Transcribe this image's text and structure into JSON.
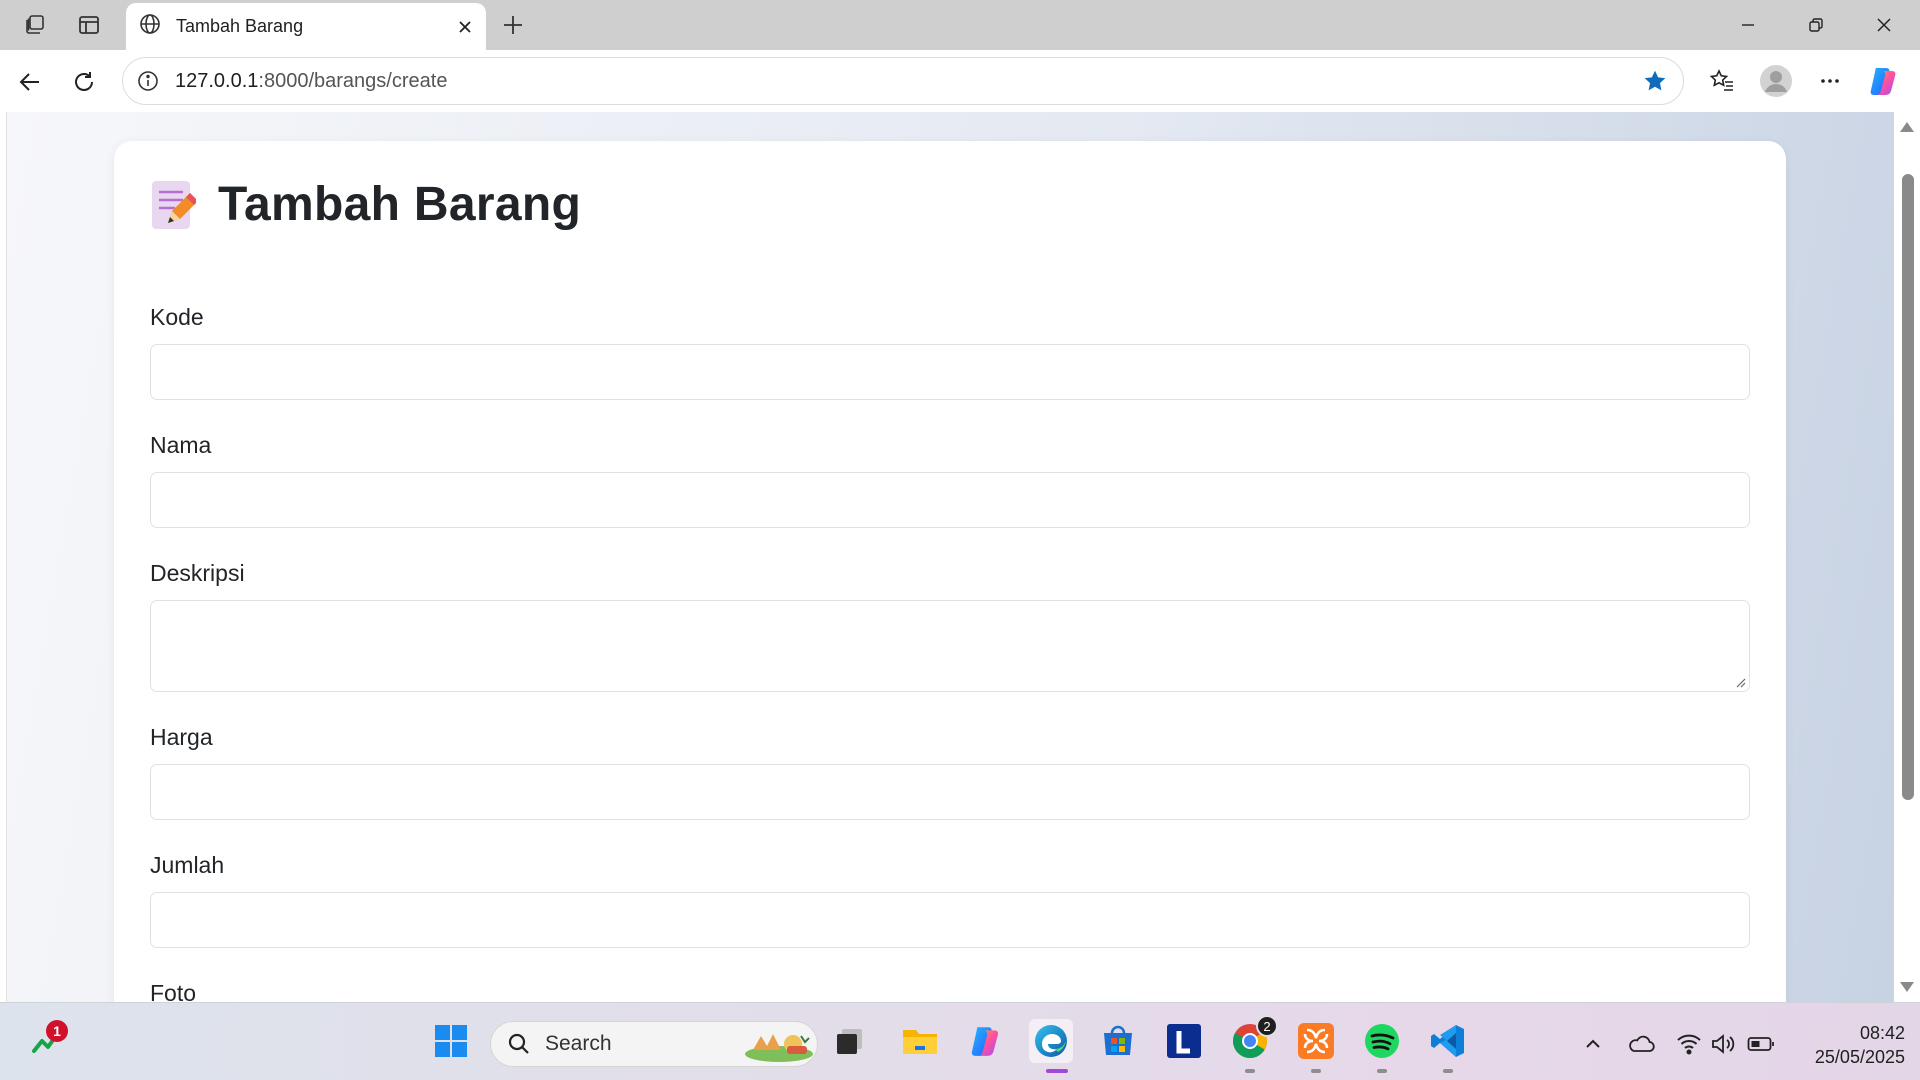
{
  "browser": {
    "tab": {
      "title": "Tambah Barang"
    },
    "address": {
      "host": "127.0.0.1",
      "path": ":8000/barangs/create"
    }
  },
  "page": {
    "title": "Tambah Barang",
    "fields": [
      {
        "label": "Kode",
        "value": ""
      },
      {
        "label": "Nama",
        "value": ""
      },
      {
        "label": "Deskripsi",
        "value": ""
      },
      {
        "label": "Harga",
        "value": ""
      },
      {
        "label": "Jumlah",
        "value": ""
      },
      {
        "label": "Foto",
        "value": ""
      }
    ]
  },
  "taskbar": {
    "search_placeholder": "Search",
    "widget_badge": "1",
    "chrome_badge": "2",
    "time": "08:42",
    "date": "25/05/2025"
  },
  "colors": {
    "accent": "#0f6cbd",
    "title_text": "#212529",
    "field_border": "#dee2e6"
  }
}
